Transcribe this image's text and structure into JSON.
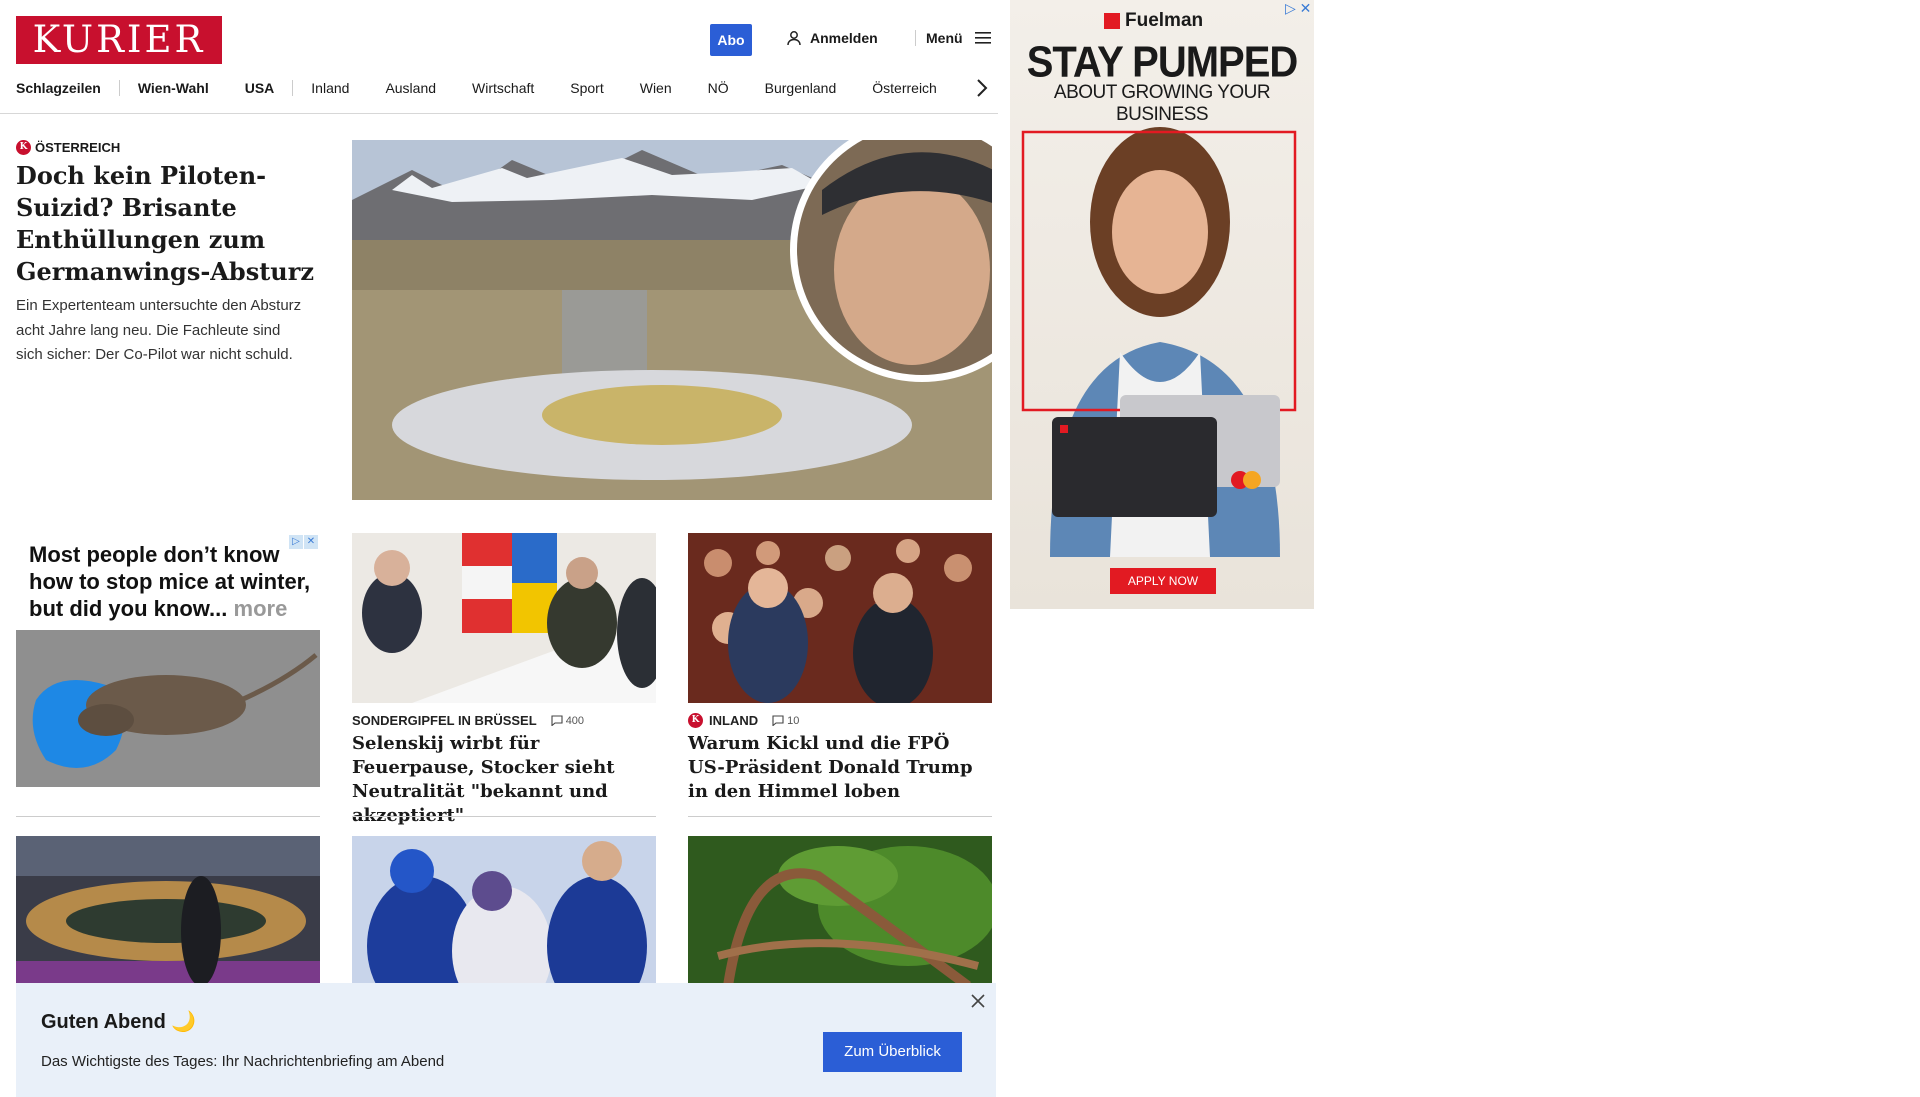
{
  "header": {
    "logo": "KURIER",
    "abo": "Abo",
    "login": "Anmelden",
    "menu": "Menü",
    "nav": [
      "Schlagzeilen",
      "Wien-Wahl",
      "USA",
      "Inland",
      "Ausland",
      "Wirtschaft",
      "Sport",
      "Wien",
      "NÖ",
      "Burgenland",
      "Österreich"
    ]
  },
  "lead": {
    "category": "ÖSTERREICH",
    "title": "Doch kein Piloten-Suizid? Brisante Enthüllungen zum Germanwings-Absturz",
    "teaser": "Ein Expertenteam untersuchte den Absturz acht Jahre lang neu. Die Fachleute sind sich sicher: Der Co-Pilot war nicht schuld."
  },
  "ad_mice": {
    "text": "Most people don’t know how to stop mice at winter, but did you know...",
    "more": "more"
  },
  "cards": [
    {
      "category": "SONDERGIPFEL IN BRÜSSEL",
      "comments": "400",
      "title": "Selenskij wirbt für Feuerpause, Stocker sieht Neutralität \"bekannt und akzeptiert\""
    },
    {
      "category": "INLAND",
      "comments": "10",
      "title": "Warum Kickl und die FPÖ US-Präsident Donald Trump in den Himmel loben"
    }
  ],
  "ad_right": {
    "brand": "Fuelman",
    "headline": "STAY PUMPED",
    "subline": "ABOUT GROWING YOUR BUSINESS",
    "button": "APPLY NOW"
  },
  "briefing": {
    "title": "Guten Abend 🌙",
    "subtitle": "Das Wichtigste des Tages: Ihr Nachrichtenbriefing am Abend",
    "button": "Zum Überblick"
  }
}
